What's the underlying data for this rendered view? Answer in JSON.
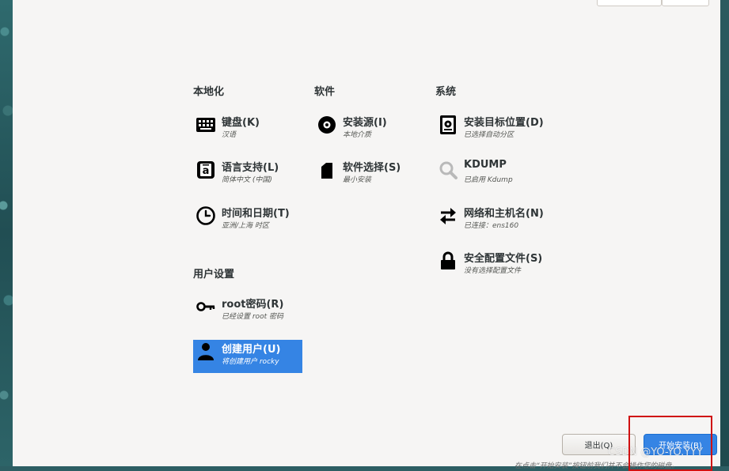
{
  "sections": {
    "localization": "本地化",
    "software": "软件",
    "system": "系统",
    "user_settings": "用户设置"
  },
  "spokes": {
    "keyboard": {
      "name": "键盘(K)",
      "status": "汉语",
      "icon": "keyboard-icon"
    },
    "language": {
      "name": "语言支持(L)",
      "status": "简体中文 (中国)",
      "icon": "language-icon"
    },
    "time": {
      "name": "时间和日期(T)",
      "status": "亚洲/上海 时区",
      "icon": "clock-icon"
    },
    "source": {
      "name": "安装源(I)",
      "status": "本地介质",
      "icon": "disc-icon"
    },
    "software_selection": {
      "name": "软件选择(S)",
      "status": "最小安装",
      "icon": "package-icon"
    },
    "destination": {
      "name": "安装目标位置(D)",
      "status": "已选择自动分区",
      "icon": "harddisk-icon"
    },
    "kdump": {
      "name": "KDUMP",
      "status": "已启用 Kdump",
      "icon": "magnifier-icon"
    },
    "network": {
      "name": "网络和主机名(N)",
      "status": "已连接：ens160",
      "icon": "network-arrows-icon"
    },
    "security": {
      "name": "安全配置文件(S)",
      "status": "没有选择配置文件",
      "icon": "lock-icon"
    },
    "root": {
      "name": "root密码(R)",
      "status": "已经设置 root 密码",
      "icon": "key-icon"
    },
    "user": {
      "name": "创建用户(U)",
      "status": "将创建用户 rocky",
      "icon": "user-icon"
    }
  },
  "buttons": {
    "quit": "退出(Q)",
    "begin": "开始安装(B)"
  },
  "footnote": "在点击“开始安装”按钮前我们并不会操作您的磁盘。",
  "watermark": "CSDN @YO-YO.YYY",
  "colors": {
    "accent": "#3584e4",
    "highlight": "#d01010"
  }
}
